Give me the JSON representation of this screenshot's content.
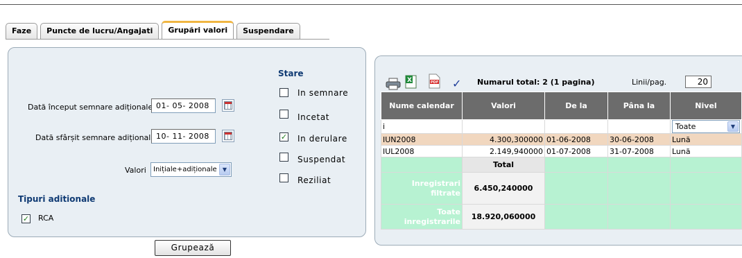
{
  "tabs": [
    {
      "label": "Faze"
    },
    {
      "label": "Puncte de lucru/Angajati"
    },
    {
      "label": "Grupări valori"
    },
    {
      "label": "Suspendare"
    }
  ],
  "filters": {
    "start_date_label": "Dată început semnare adiționale",
    "start_date_value": "01- 05-  2008",
    "end_date_label": "Dată sfârșit semnare adiționale",
    "end_date_value": "10- 11-  2008",
    "valori_label": "Valori",
    "valori_selected": "Inițiale+adiționale"
  },
  "stare": {
    "title": "Stare",
    "options": [
      {
        "label": "In semnare",
        "checked": false
      },
      {
        "label": "Incetat",
        "checked": false
      },
      {
        "label": "In derulare",
        "checked": true
      },
      {
        "label": "Suspendat",
        "checked": false
      },
      {
        "label": "Reziliat",
        "checked": false
      }
    ]
  },
  "tipuri": {
    "title": "Tipuri aditionale",
    "options": [
      {
        "label": "RCA",
        "checked": true
      }
    ]
  },
  "group_button": "Grupează",
  "toolbar": {
    "icons": [
      "printer-icon",
      "excel-icon",
      "pdf-icon",
      "check-icon"
    ],
    "total_text": "Numarul total: 2 (1 pagina)",
    "lines_label": "Linii/pag.",
    "lines_value": "20"
  },
  "table": {
    "headers": [
      "Nume calendar",
      "Valori",
      "De la",
      "Pâna la",
      "Nivel"
    ],
    "filter": {
      "nume": "i",
      "nivel": "Toate"
    },
    "rows": [
      {
        "nume": "IUN2008",
        "valori": "4.300,300000",
        "de_la": "01-06-2008",
        "pana_la": "30-06-2008",
        "nivel": "Lună"
      },
      {
        "nume": "IUL2008",
        "valori": "2.149,940000",
        "de_la": "01-07-2008",
        "pana_la": "31-07-2008",
        "nivel": "Lună"
      }
    ],
    "total_header": "Total",
    "summary": [
      {
        "label": "Inregistrari filtrate",
        "value": "6.450,240000"
      },
      {
        "label": "Toate inregistrarile",
        "value": "18.920,060000"
      }
    ]
  },
  "colors": {
    "panel_bg": "#e9eff4",
    "header_bg": "#6c6c6c",
    "selected_row": "#f1d7bf",
    "summary_bg": "#b7f2d2",
    "section_title": "#0f3a73",
    "active_tab_accent": "#f0b642"
  }
}
